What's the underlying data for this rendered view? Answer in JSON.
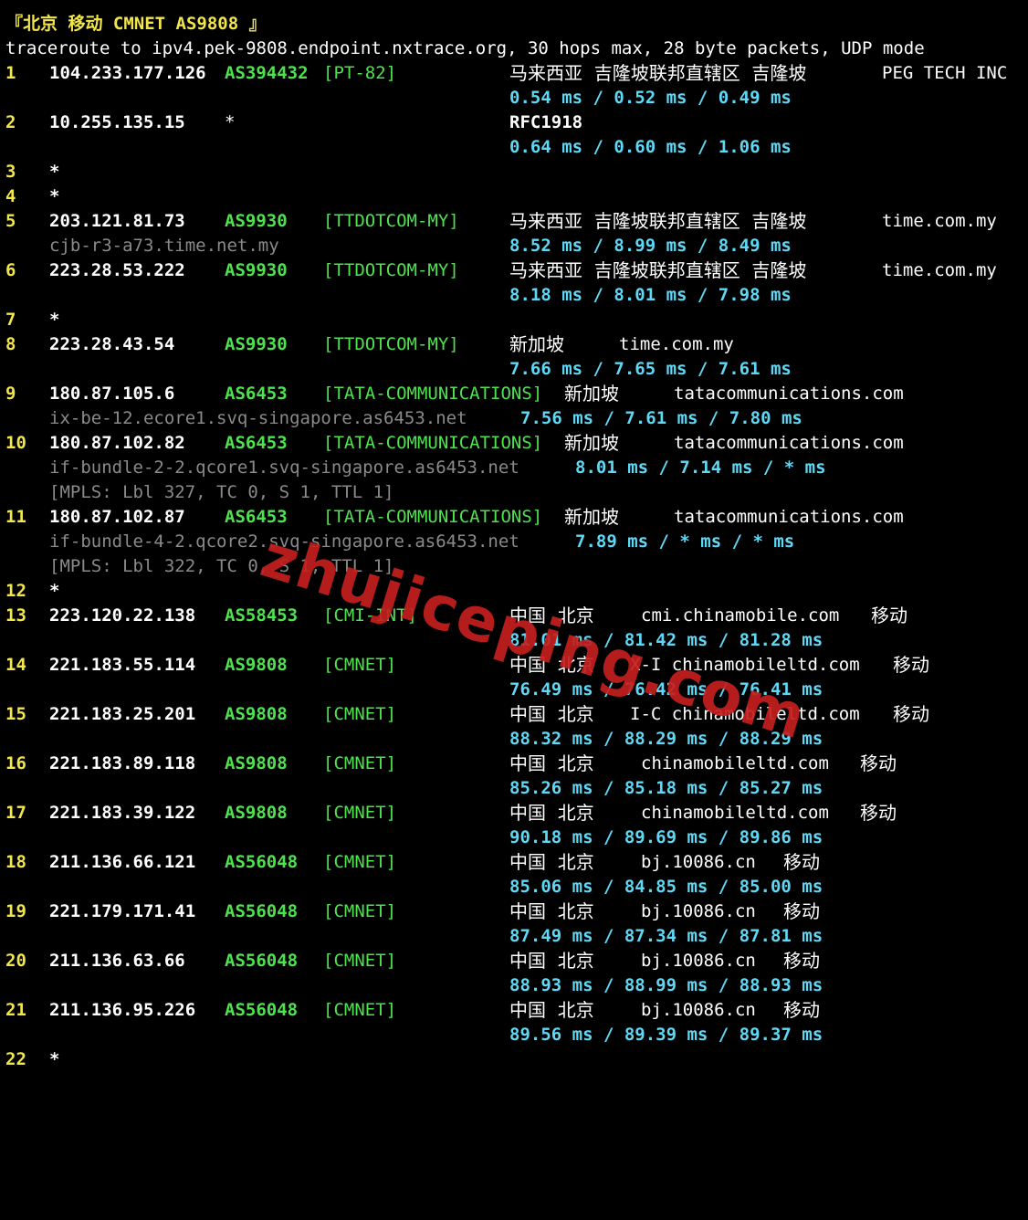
{
  "title": "『北京 移动 CMNET AS9808 』",
  "header": "traceroute to ipv4.pek-9808.endpoint.nxtrace.org, 30 hops max, 28 byte packets, UDP mode",
  "watermark": "zhujiceping.com",
  "colors": {
    "background": "#000000",
    "hop_number": "#f2e64b",
    "asn": "#4ee34e",
    "rtt": "#5fd8f5",
    "ptr": "#8a8a8a",
    "watermark": "#c4201e"
  },
  "hops": [
    {
      "hop": "1",
      "ip": "104.233.177.126",
      "asn": "AS394432",
      "tag": "[PT-82]",
      "geo": "马来西亚  吉隆坡联邦直辖区  吉隆坡",
      "domain": "PEG TECH INC",
      "rtt": "0.54 ms / 0.52 ms / 0.49 ms"
    },
    {
      "hop": "2",
      "ip": "10.255.135.15",
      "asn": "*",
      "geo": "RFC1918",
      "rtt": "0.64 ms / 0.60 ms / 1.06 ms"
    },
    {
      "hop": "3",
      "star": "*"
    },
    {
      "hop": "4",
      "star": "*"
    },
    {
      "hop": "5",
      "ip": "203.121.81.73",
      "asn": "AS9930",
      "tag": "[TTDOTCOM-MY]",
      "geo": "马来西亚  吉隆坡联邦直辖区  吉隆坡",
      "domain": "time.com.my",
      "ptr": "cjb-r3-a73.time.net.my",
      "rtt": "8.52 ms / 8.99 ms / 8.49 ms"
    },
    {
      "hop": "6",
      "ip": "223.28.53.222",
      "asn": "AS9930",
      "tag": "[TTDOTCOM-MY]",
      "geo": "马来西亚  吉隆坡联邦直辖区  吉隆坡",
      "domain": "time.com.my",
      "rtt": "8.18 ms / 8.01 ms / 7.98 ms"
    },
    {
      "hop": "7",
      "star": "*"
    },
    {
      "hop": "8",
      "ip": "223.28.43.54",
      "asn": "AS9930",
      "tag": "[TTDOTCOM-MY]",
      "geo": "新加坡",
      "domain": "time.com.my",
      "rtt": "7.66 ms / 7.65 ms / 7.61 ms"
    },
    {
      "hop": "9",
      "ip": "180.87.105.6",
      "asn": "AS6453",
      "tag": "[TATA-COMMUNICATIONS]",
      "geo": "新加坡",
      "domain": "tatacommunications.com",
      "ptr": "ix-be-12.ecore1.svq-singapore.as6453.net",
      "rtt": "7.56 ms / 7.61 ms / 7.80 ms"
    },
    {
      "hop": "10",
      "ip": "180.87.102.82",
      "asn": "AS6453",
      "tag": "[TATA-COMMUNICATIONS]",
      "geo": "新加坡",
      "domain": "tatacommunications.com",
      "ptr": "if-bundle-2-2.qcore1.svq-singapore.as6453.net",
      "rtt": "8.01 ms / 7.14 ms / * ms",
      "mpls": "[MPLS: Lbl 327, TC 0, S 1, TTL 1]"
    },
    {
      "hop": "11",
      "ip": "180.87.102.87",
      "asn": "AS6453",
      "tag": "[TATA-COMMUNICATIONS]",
      "geo": "新加坡",
      "domain": "tatacommunications.com",
      "ptr": "if-bundle-4-2.qcore2.svq-singapore.as6453.net",
      "rtt": "7.89 ms / * ms / * ms",
      "mpls": "[MPLS: Lbl 322, TC 0, S 1, TTL 1]"
    },
    {
      "hop": "12",
      "star": "*"
    },
    {
      "hop": "13",
      "ip": "223.120.22.138",
      "asn": "AS58453",
      "tag": "[CMI-INT]",
      "geo": "中国  北京",
      "domain": "cmi.chinamobile.com",
      "isp": "移动",
      "rtt": "81.01 ms / 81.42 ms / 81.28 ms"
    },
    {
      "hop": "14",
      "ip": "221.183.55.114",
      "asn": "AS9808",
      "tag": "[CMNET]",
      "geo": "中国  北京",
      "domain": "X-I chinamobileltd.com",
      "isp": "移动",
      "rtt": "76.49 ms / 76.42 ms / 76.41 ms"
    },
    {
      "hop": "15",
      "ip": "221.183.25.201",
      "asn": "AS9808",
      "tag": "[CMNET]",
      "geo": "中国  北京",
      "domain": "I-C chinamobileltd.com",
      "isp": "移动",
      "rtt": "88.32 ms / 88.29 ms / 88.29 ms"
    },
    {
      "hop": "16",
      "ip": "221.183.89.118",
      "asn": "AS9808",
      "tag": "[CMNET]",
      "geo": "中国  北京",
      "domain": "chinamobileltd.com",
      "isp": "移动",
      "rtt": "85.26 ms / 85.18 ms / 85.27 ms"
    },
    {
      "hop": "17",
      "ip": "221.183.39.122",
      "asn": "AS9808",
      "tag": "[CMNET]",
      "geo": "中国  北京",
      "domain": "chinamobileltd.com",
      "isp": "移动",
      "rtt": "90.18 ms / 89.69 ms / 89.86 ms"
    },
    {
      "hop": "18",
      "ip": "211.136.66.121",
      "asn": "AS56048",
      "tag": "[CMNET]",
      "geo": "中国  北京",
      "domain": "bj.10086.cn",
      "isp": "移动",
      "rtt": "85.06 ms / 84.85 ms / 85.00 ms"
    },
    {
      "hop": "19",
      "ip": "221.179.171.41",
      "asn": "AS56048",
      "tag": "[CMNET]",
      "geo": "中国  北京",
      "domain": "bj.10086.cn",
      "isp": "移动",
      "rtt": "87.49 ms / 87.34 ms / 87.81 ms"
    },
    {
      "hop": "20",
      "ip": "211.136.63.66",
      "asn": "AS56048",
      "tag": "[CMNET]",
      "geo": "中国  北京",
      "domain": "bj.10086.cn",
      "isp": "移动",
      "rtt": "88.93 ms / 88.99 ms / 88.93 ms"
    },
    {
      "hop": "21",
      "ip": "211.136.95.226",
      "asn": "AS56048",
      "tag": "[CMNET]",
      "geo": "中国  北京",
      "domain": "bj.10086.cn",
      "isp": "移动",
      "rtt": "89.56 ms / 89.39 ms / 89.37 ms"
    },
    {
      "hop": "22",
      "star": "*"
    }
  ]
}
